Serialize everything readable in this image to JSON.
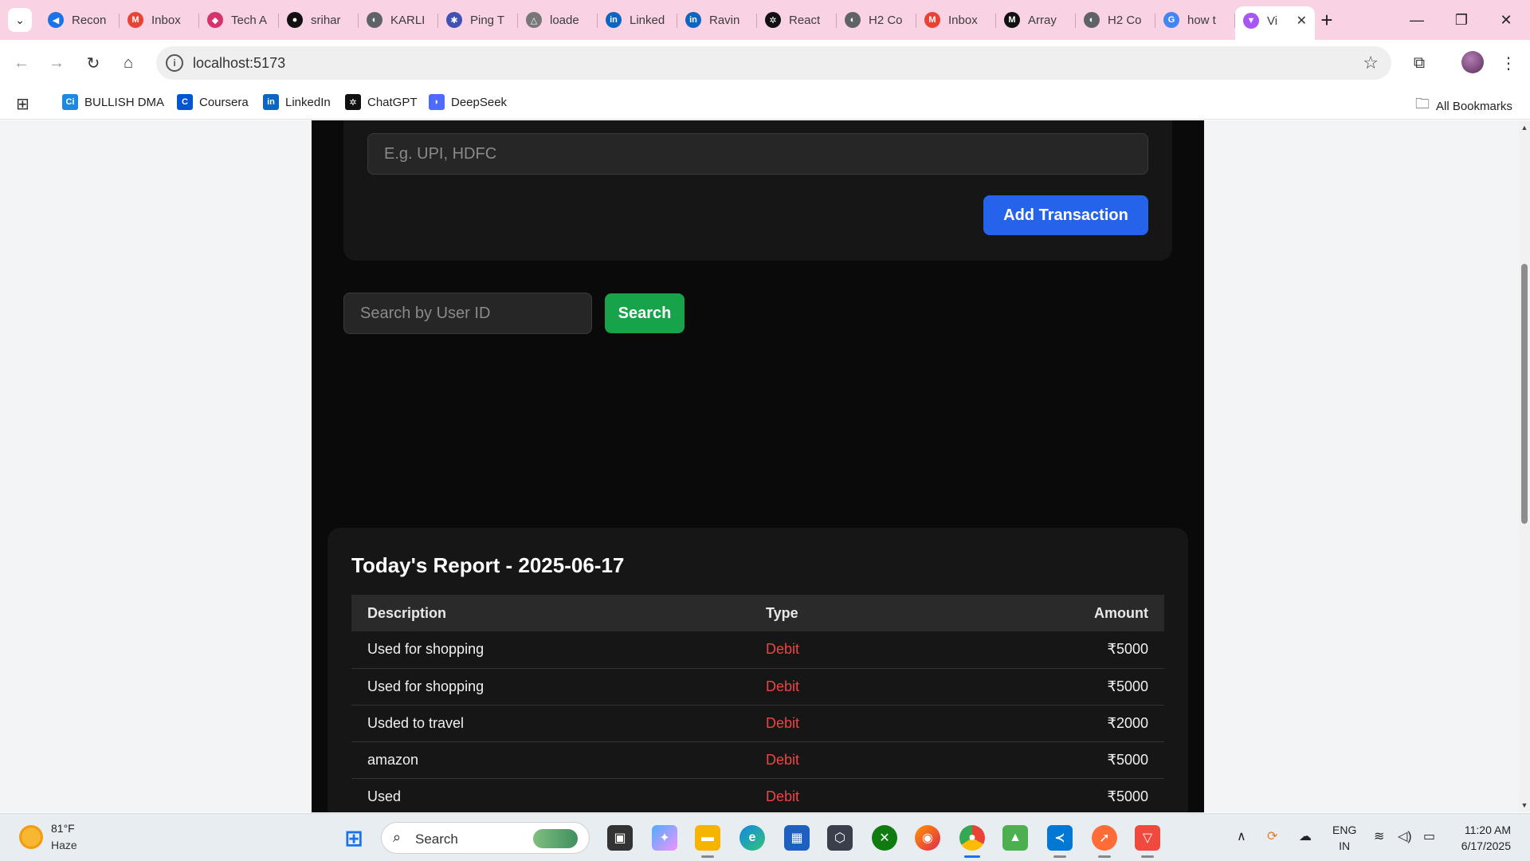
{
  "browser": {
    "tabs": [
      {
        "label": "Recon",
        "icon": "recon-icon",
        "color": "#1a73e8",
        "glyph": "◀"
      },
      {
        "label": "Inbox",
        "icon": "gmail-icon",
        "color": "#ea4335",
        "glyph": "M"
      },
      {
        "label": "Tech A",
        "icon": "shield-icon",
        "color": "#d6336c",
        "glyph": "◆"
      },
      {
        "label": "srihar",
        "icon": "github-icon",
        "color": "#111111",
        "glyph": "●"
      },
      {
        "label": "KARLI",
        "icon": "chrome-globe-icon",
        "color": "#5f6368",
        "glyph": "◐"
      },
      {
        "label": "Ping T",
        "icon": "network-icon",
        "color": "#3f51b5",
        "glyph": "✱"
      },
      {
        "label": "loade",
        "icon": "triangle-icon",
        "color": "#777777",
        "glyph": "△"
      },
      {
        "label": "Linked",
        "icon": "linkedin-icon",
        "color": "#0a66c2",
        "glyph": "in"
      },
      {
        "label": "Ravin",
        "icon": "linkedin-icon",
        "color": "#0a66c2",
        "glyph": "in"
      },
      {
        "label": "React",
        "icon": "openai-icon",
        "color": "#111111",
        "glyph": "✲"
      },
      {
        "label": "H2 Co",
        "icon": "chrome-globe-icon",
        "color": "#5f6368",
        "glyph": "◐"
      },
      {
        "label": "Inbox",
        "icon": "gmail-icon",
        "color": "#ea4335",
        "glyph": "M"
      },
      {
        "label": "Array",
        "icon": "medium-icon",
        "color": "#111111",
        "glyph": "M"
      },
      {
        "label": "H2 Co",
        "icon": "chrome-globe-icon",
        "color": "#5f6368",
        "glyph": "◐"
      },
      {
        "label": "how t",
        "icon": "google-icon",
        "color": "#4285f4",
        "glyph": "G"
      },
      {
        "label": "Vi",
        "icon": "vite-icon",
        "color": "#a855f7",
        "glyph": "▼"
      }
    ],
    "url": "localhost:5173",
    "bookmarks": [
      {
        "label": "BULLISH DMA",
        "icon": "bullish-icon",
        "color": "#1e88e5",
        "glyph": "Ci"
      },
      {
        "label": "Coursera",
        "icon": "coursera-icon",
        "color": "#0056d2",
        "glyph": "C"
      },
      {
        "label": "LinkedIn",
        "icon": "linkedin-icon",
        "color": "#0a66c2",
        "glyph": "in"
      },
      {
        "label": "ChatGPT",
        "icon": "openai-icon",
        "color": "#111111",
        "glyph": "✲"
      },
      {
        "label": "DeepSeek",
        "icon": "deepseek-icon",
        "color": "#4d6bfe",
        "glyph": "◗"
      }
    ],
    "all_bookmarks": "All Bookmarks"
  },
  "app": {
    "method_placeholder": "E.g. UPI, HDFC",
    "add_button": "Add Transaction",
    "search_placeholder": "Search by User ID",
    "search_button": "Search",
    "report": {
      "title": "Today's Report - 2025-06-17",
      "columns": [
        "Description",
        "Type",
        "Amount"
      ],
      "rows": [
        {
          "description": "Used for shopping",
          "type": "Debit",
          "amount": "₹5000"
        },
        {
          "description": "Used for shopping",
          "type": "Debit",
          "amount": "₹5000"
        },
        {
          "description": "Usded to travel",
          "type": "Debit",
          "amount": "₹2000"
        },
        {
          "description": "amazon",
          "type": "Debit",
          "amount": "₹5000"
        },
        {
          "description": "Used",
          "type": "Debit",
          "amount": "₹5000"
        }
      ]
    }
  },
  "taskbar": {
    "temperature": "81°F",
    "condition": "Haze",
    "search_label": "Search",
    "lang_1": "ENG",
    "lang_2": "IN",
    "time": "11:20 AM",
    "date": "6/17/2025"
  }
}
